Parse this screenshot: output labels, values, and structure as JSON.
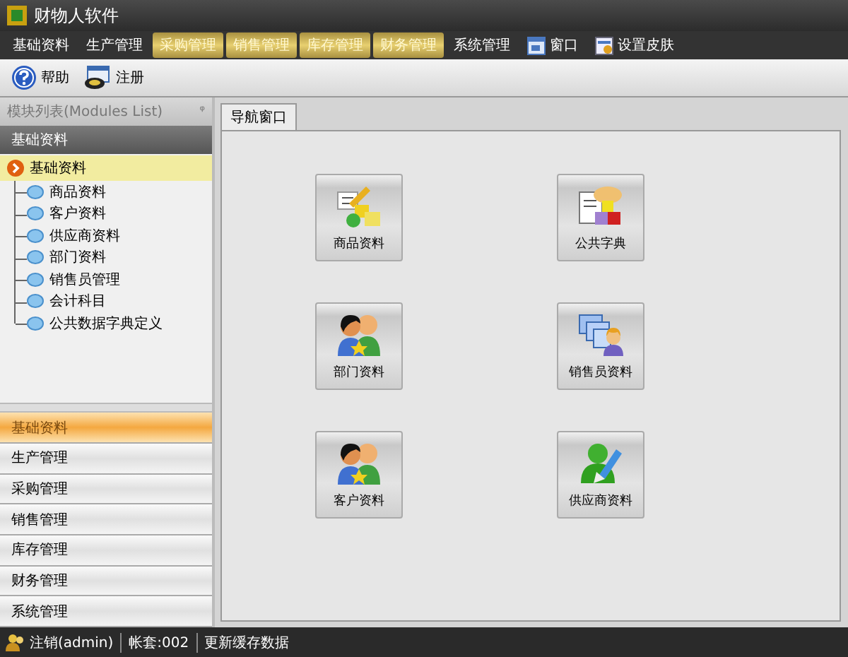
{
  "window": {
    "title": "财物人软件"
  },
  "menu": [
    {
      "label": "基础资料",
      "highlighted": false,
      "kind": "text"
    },
    {
      "label": "生产管理",
      "highlighted": false,
      "kind": "text"
    },
    {
      "label": "采购管理",
      "highlighted": true,
      "kind": "text"
    },
    {
      "label": "销售管理",
      "highlighted": true,
      "kind": "text"
    },
    {
      "label": "库存管理",
      "highlighted": true,
      "kind": "text"
    },
    {
      "label": "财务管理",
      "highlighted": true,
      "kind": "text"
    },
    {
      "label": "系统管理",
      "highlighted": false,
      "kind": "text"
    },
    {
      "label": "窗口",
      "highlighted": false,
      "kind": "window"
    },
    {
      "label": "设置皮肤",
      "highlighted": false,
      "kind": "skin"
    }
  ],
  "toolbar": [
    {
      "label": "帮助",
      "kind": "help"
    },
    {
      "label": "注册",
      "kind": "register"
    }
  ],
  "sidebar": {
    "title": "模块列表(Modules List)",
    "pin": "ᵠ",
    "group_title": "基础资料",
    "tree": {
      "label": "基础资料",
      "selected": true,
      "children": [
        {
          "label": "商品资料"
        },
        {
          "label": "客户资料"
        },
        {
          "label": "供应商资料"
        },
        {
          "label": "部门资料"
        },
        {
          "label": "销售员管理"
        },
        {
          "label": "会计科目"
        },
        {
          "label": "公共数据字典定义"
        }
      ]
    },
    "modules": [
      {
        "label": "基础资料",
        "selected": true
      },
      {
        "label": "生产管理",
        "selected": false
      },
      {
        "label": "采购管理",
        "selected": false
      },
      {
        "label": "销售管理",
        "selected": false
      },
      {
        "label": "库存管理",
        "selected": false
      },
      {
        "label": "财务管理",
        "selected": false
      },
      {
        "label": "系统管理",
        "selected": false
      }
    ]
  },
  "tabs": [
    {
      "label": "导航窗口",
      "selected": true
    }
  ],
  "tiles": [
    {
      "label": "商品资料",
      "kind": "goods"
    },
    {
      "label": "公共字典",
      "kind": "dictionary"
    },
    {
      "label": "部门资料",
      "kind": "people"
    },
    {
      "label": "销售员资料",
      "kind": "salesman"
    },
    {
      "label": "客户资料",
      "kind": "people"
    },
    {
      "label": "供应商资料",
      "kind": "supplier"
    }
  ],
  "status_bar": [
    {
      "label": "注销(admin)",
      "kind": "user"
    },
    {
      "label": "帐套:002",
      "kind": "text"
    },
    {
      "label": "更新缓存数据",
      "kind": "text"
    }
  ]
}
